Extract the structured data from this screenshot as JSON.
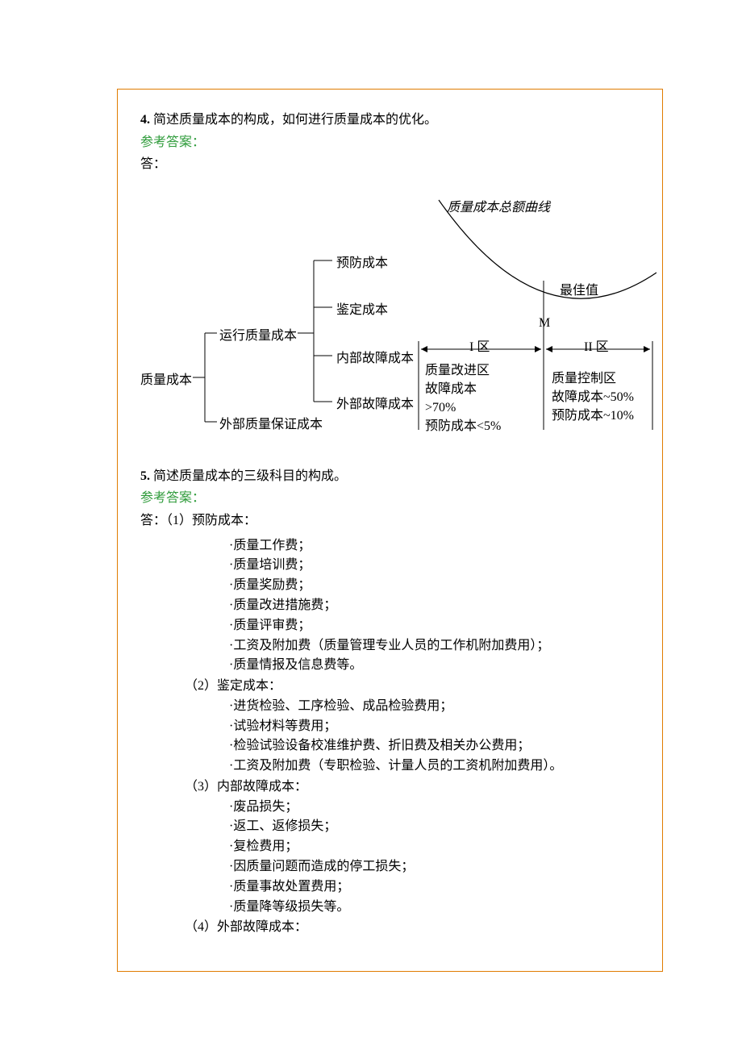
{
  "q4": {
    "num": "4.",
    "text": " 简述质量成本的构成，如何进行质量成本的优化。",
    "ref": "参考答案：",
    "ans": "答："
  },
  "diagram": {
    "root": "质量成本",
    "branch1": "运行质量成本",
    "branch2": "外部质量保证成本",
    "leaf1": "预防成本",
    "leaf2": "鉴定成本",
    "leaf3": "内部故障成本",
    "leaf4": "外部故障成本",
    "curve": "质量成本总额曲线",
    "best": "最佳值",
    "m": "M",
    "zone1": "I 区",
    "zone2": "II 区",
    "z1t": "质量改进区",
    "z1a": "故障成本",
    "z1b": ">70%",
    "z1c": "预防成本<5%",
    "z2t": "质量控制区",
    "z2a": "故障成本~50%",
    "z2b": "预防成本~10%"
  },
  "q5": {
    "num": "5.",
    "text": " 简述质量成本的三级科目的构成。",
    "ref": "参考答案：",
    "ans_lead": "答：（1）预防成本：",
    "s1": [
      "·质量工作费；",
      "·质量培训费；",
      "·质量奖励费；",
      "·质量改进措施费；",
      "·质量评审费；",
      "·工资及附加费（质量管理专业人员的工作机附加费用）；",
      "·质量情报及信息费等。"
    ],
    "h2": "（2）鉴定成本：",
    "s2": [
      "·进货检验、工序检验、成品检验费用；",
      "·试验材料等费用；",
      "·检验试验设备校准维护费、折旧费及相关办公费用；",
      "·工资及附加费（专职检验、计量人员的工资机附加费用）。"
    ],
    "h3": "（3）内部故障成本：",
    "s3": [
      "·废品损失；",
      "·返工、返修损失；",
      "·复检费用；",
      "·因质量问题而造成的停工损失；",
      "·质量事故处置费用；",
      "·质量降等级损失等。"
    ],
    "h4": "（4）外部故障成本："
  },
  "chart_data": {
    "type": "line",
    "title": "质量成本总额曲线",
    "xlabel": "",
    "ylabel": "",
    "series": [
      {
        "name": "质量成本总额曲线",
        "shape": "U-curve with minimum at M (最佳值)"
      }
    ],
    "zones": [
      {
        "name": "I 区 质量改进区",
        "故障成本": ">70%",
        "预防成本": "<5%"
      },
      {
        "name": "II 区 质量控制区",
        "故障成本": "~50%",
        "预防成本": "~10%"
      }
    ],
    "annotations": [
      "最佳值",
      "M"
    ]
  }
}
